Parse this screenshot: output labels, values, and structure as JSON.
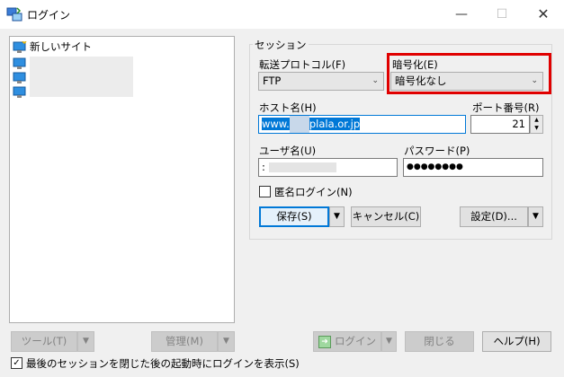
{
  "window": {
    "title": "ログイン"
  },
  "tree": {
    "items": [
      {
        "label": "新しいサイト"
      }
    ]
  },
  "session": {
    "legend": "セッション",
    "protocol": {
      "label": "転送プロトコル(F)",
      "value": "FTP"
    },
    "encryption": {
      "label": "暗号化(E)",
      "value": "暗号化なし"
    },
    "host": {
      "label": "ホスト名(H)",
      "value_prefix": "www.",
      "value_suffix": "plala.or.jp"
    },
    "port": {
      "label": "ポート番号(R)",
      "value": "21"
    },
    "user": {
      "label": "ユーザ名(U)",
      "value": ":"
    },
    "password": {
      "label": "パスワード(P)",
      "value": "●●●●●●●●"
    },
    "anonymous": {
      "label": "匿名ログイン(N)"
    },
    "save_label": "保存(S)",
    "cancel_label": "キャンセル(C)",
    "advanced_label": "設定(D)..."
  },
  "bottom": {
    "tools_label": "ツール(T)",
    "manage_label": "管理(M)",
    "login_label": "ログイン",
    "close_label": "閉じる",
    "help_label": "ヘルプ(H)",
    "show_login_label": "最後のセッションを閉じた後の起動時にログインを表示(S)"
  }
}
